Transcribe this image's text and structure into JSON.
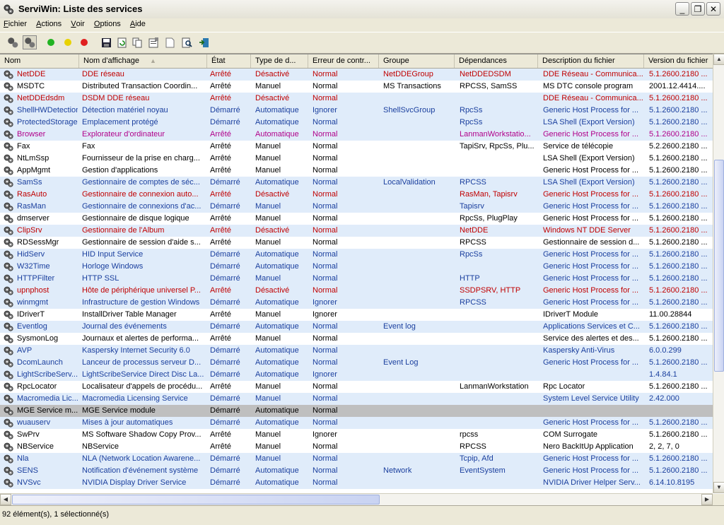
{
  "window": {
    "title": "ServiWin: Liste des services"
  },
  "menu": [
    {
      "pre": "",
      "ul": "F",
      "post": "ichier"
    },
    {
      "pre": "",
      "ul": "A",
      "post": "ctions"
    },
    {
      "pre": "",
      "ul": "V",
      "post": "oir"
    },
    {
      "pre": "",
      "ul": "O",
      "post": "ptions"
    },
    {
      "pre": "",
      "ul": "A",
      "post": "ide"
    }
  ],
  "toolbar": {
    "colors": {
      "start": "#22b322",
      "pause": "#e8d200",
      "stop": "#e02020"
    },
    "icons": [
      "services-icon",
      "drivers-icon",
      "start-icon",
      "pause-icon",
      "stop-icon",
      "save-icon",
      "refresh-icon",
      "copy-icon",
      "properties-icon",
      "html-report-icon",
      "find-icon",
      "exit-icon"
    ]
  },
  "columns": [
    "Nom",
    "Nom d'affichage",
    "État",
    "Type de d...",
    "Erreur de contr...",
    "Groupe",
    "Dépendances",
    "Description du fichier",
    "Version du fichier"
  ],
  "rows": [
    [
      "NetDDE",
      "DDE réseau",
      "Arrêté",
      "Désactivé",
      "Normal",
      "NetDDEGroup",
      "NetDDEDSDM",
      "DDE Réseau - Communica...",
      "5.1.2600.2180 ..."
    ],
    [
      "MSDTC",
      "Distributed Transaction Coordin...",
      "Arrêté",
      "Manuel",
      "Normal",
      "MS Transactions",
      "RPCSS, SamSS",
      "MS DTC console program",
      "2001.12.4414...."
    ],
    [
      "NetDDEdsdm",
      "DSDM DDE réseau",
      "Arrêté",
      "Désactivé",
      "Normal",
      "",
      "",
      "DDE Réseau - Communica...",
      "5.1.2600.2180 ..."
    ],
    [
      "ShellHWDetection",
      "Détection matériel noyau",
      "Démarré",
      "Automatique",
      "Ignorer",
      "ShellSvcGroup",
      "RpcSs",
      "Generic Host Process for ...",
      "5.1.2600.2180 ..."
    ],
    [
      "ProtectedStorage",
      "Emplacement protégé",
      "Démarré",
      "Automatique",
      "Normal",
      "",
      "RpcSs",
      "LSA Shell (Export Version)",
      "5.1.2600.2180 ..."
    ],
    [
      "Browser",
      "Explorateur d'ordinateur",
      "Arrêté",
      "Automatique",
      "Normal",
      "",
      "LanmanWorkstatio...",
      "Generic Host Process for ...",
      "5.1.2600.2180 ..."
    ],
    [
      "Fax",
      "Fax",
      "Arrêté",
      "Manuel",
      "Normal",
      "",
      "TapiSrv, RpcSs, Plu...",
      "Service de télécopie",
      "5.2.2600.2180 ..."
    ],
    [
      "NtLmSsp",
      "Fournisseur de la prise en charg...",
      "Arrêté",
      "Manuel",
      "Normal",
      "",
      "",
      "LSA Shell (Export Version)",
      "5.1.2600.2180 ..."
    ],
    [
      "AppMgmt",
      "Gestion d'applications",
      "Arrêté",
      "Manuel",
      "Normal",
      "",
      "",
      "Generic Host Process for ...",
      "5.1.2600.2180 ..."
    ],
    [
      "SamSs",
      "Gestionnaire de comptes de séc...",
      "Démarré",
      "Automatique",
      "Normal",
      "LocalValidation",
      "RPCSS",
      "LSA Shell (Export Version)",
      "5.1.2600.2180 ..."
    ],
    [
      "RasAuto",
      "Gestionnaire de connexion auto...",
      "Arrêté",
      "Désactivé",
      "Normal",
      "",
      "RasMan, Tapisrv",
      "Generic Host Process for ...",
      "5.1.2600.2180 ..."
    ],
    [
      "RasMan",
      "Gestionnaire de connexions d'ac...",
      "Démarré",
      "Manuel",
      "Normal",
      "",
      "Tapisrv",
      "Generic Host Process for ...",
      "5.1.2600.2180 ..."
    ],
    [
      "dmserver",
      "Gestionnaire de disque logique",
      "Arrêté",
      "Manuel",
      "Normal",
      "",
      "RpcSs, PlugPlay",
      "Generic Host Process for ...",
      "5.1.2600.2180 ..."
    ],
    [
      "ClipSrv",
      "Gestionnaire de l'Album",
      "Arrêté",
      "Désactivé",
      "Normal",
      "",
      "NetDDE",
      "Windows NT DDE Server",
      "5.1.2600.2180 ..."
    ],
    [
      "RDSessMgr",
      "Gestionnaire de session d'aide s...",
      "Arrêté",
      "Manuel",
      "Normal",
      "",
      "RPCSS",
      "Gestionnaire de session d...",
      "5.1.2600.2180 ..."
    ],
    [
      "HidServ",
      "HID Input Service",
      "Démarré",
      "Automatique",
      "Normal",
      "",
      "RpcSs",
      "Generic Host Process for ...",
      "5.1.2600.2180 ..."
    ],
    [
      "W32Time",
      "Horloge Windows",
      "Démarré",
      "Automatique",
      "Normal",
      "",
      "",
      "Generic Host Process for ...",
      "5.1.2600.2180 ..."
    ],
    [
      "HTTPFilter",
      "HTTP SSL",
      "Démarré",
      "Manuel",
      "Normal",
      "",
      "HTTP",
      "Generic Host Process for ...",
      "5.1.2600.2180 ..."
    ],
    [
      "upnphost",
      "Hôte de périphérique universel P...",
      "Arrêté",
      "Désactivé",
      "Normal",
      "",
      "SSDPSRV, HTTP",
      "Generic Host Process for ...",
      "5.1.2600.2180 ..."
    ],
    [
      "winmgmt",
      "Infrastructure de gestion Windows",
      "Démarré",
      "Automatique",
      "Ignorer",
      "",
      "RPCSS",
      "Generic Host Process for ...",
      "5.1.2600.2180 ..."
    ],
    [
      "IDriverT",
      "InstallDriver Table Manager",
      "Arrêté",
      "Manuel",
      "Ignorer",
      "",
      "",
      "IDriverT Module",
      "11.00.28844"
    ],
    [
      "Eventlog",
      "Journal des événements",
      "Démarré",
      "Automatique",
      "Normal",
      "Event log",
      "",
      "Applications Services et C...",
      "5.1.2600.2180 ..."
    ],
    [
      "SysmonLog",
      "Journaux et alertes de performa...",
      "Arrêté",
      "Manuel",
      "Normal",
      "",
      "",
      "Service des alertes et des...",
      "5.1.2600.2180 ..."
    ],
    [
      "AVP",
      "Kaspersky Internet Security 6.0",
      "Démarré",
      "Automatique",
      "Normal",
      "",
      "",
      "Kaspersky Anti-Virus",
      "6.0.0.299"
    ],
    [
      "DcomLaunch",
      "Lanceur de processus serveur D...",
      "Démarré",
      "Automatique",
      "Normal",
      "Event Log",
      "",
      "Generic Host Process for ...",
      "5.1.2600.2180 ..."
    ],
    [
      "LightScribeServ...",
      "LightScribeService Direct Disc La...",
      "Démarré",
      "Automatique",
      "Ignorer",
      "",
      "",
      "",
      "1.4.84.1"
    ],
    [
      "RpcLocator",
      "Localisateur d'appels de procédu...",
      "Arrêté",
      "Manuel",
      "Normal",
      "",
      "LanmanWorkstation",
      "Rpc Locator",
      "5.1.2600.2180 ..."
    ],
    [
      "Macromedia Lic...",
      "Macromedia Licensing Service",
      "Démarré",
      "Manuel",
      "Normal",
      "",
      "",
      "System Level Service Utility",
      "2.42.000"
    ],
    [
      "MGE Service m...",
      "MGE Service module",
      "Démarré",
      "Automatique",
      "Normal",
      "",
      "",
      "",
      ""
    ],
    [
      "wuauserv",
      "Mises à jour automatiques",
      "Démarré",
      "Automatique",
      "Normal",
      "",
      "",
      "Generic Host Process for ...",
      "5.1.2600.2180 ..."
    ],
    [
      "SwPrv",
      "MS Software Shadow Copy Prov...",
      "Arrêté",
      "Manuel",
      "Ignorer",
      "",
      "rpcss",
      "COM Surrogate",
      "5.1.2600.2180 ..."
    ],
    [
      "NBService",
      "NBService",
      "Arrêté",
      "Manuel",
      "Normal",
      "",
      "RPCSS",
      "Nero BackItUp Application",
      "2, 2, 7, 0"
    ],
    [
      "Nla",
      "NLA (Network Location Awarene...",
      "Démarré",
      "Manuel",
      "Normal",
      "",
      "Tcpip, Afd",
      "Generic Host Process for ...",
      "5.1.2600.2180 ..."
    ],
    [
      "SENS",
      "Notification d'événement système",
      "Démarré",
      "Automatique",
      "Normal",
      "Network",
      "EventSystem",
      "Generic Host Process for ...",
      "5.1.2600.2180 ..."
    ],
    [
      "NVSvc",
      "NVIDIA Display Driver Service",
      "Démarré",
      "Automatique",
      "Normal",
      "",
      "",
      "NVIDIA Driver Helper Serv...",
      "6.14.10.8195"
    ]
  ],
  "row_styles": [
    "dis",
    "stop",
    "dis",
    "run",
    "run",
    "pink",
    "stop",
    "stop",
    "stop",
    "run",
    "dis",
    "run",
    "stop",
    "dis",
    "stop",
    "run",
    "run",
    "run",
    "dis",
    "run",
    "stop",
    "run",
    "stop",
    "run",
    "run",
    "run",
    "stop",
    "run",
    "sel",
    "run",
    "stop",
    "stop",
    "run",
    "run",
    "run"
  ],
  "selected_index": 28,
  "statusbar": {
    "text": "92 élément(s), 1 sélectionné(s)"
  }
}
